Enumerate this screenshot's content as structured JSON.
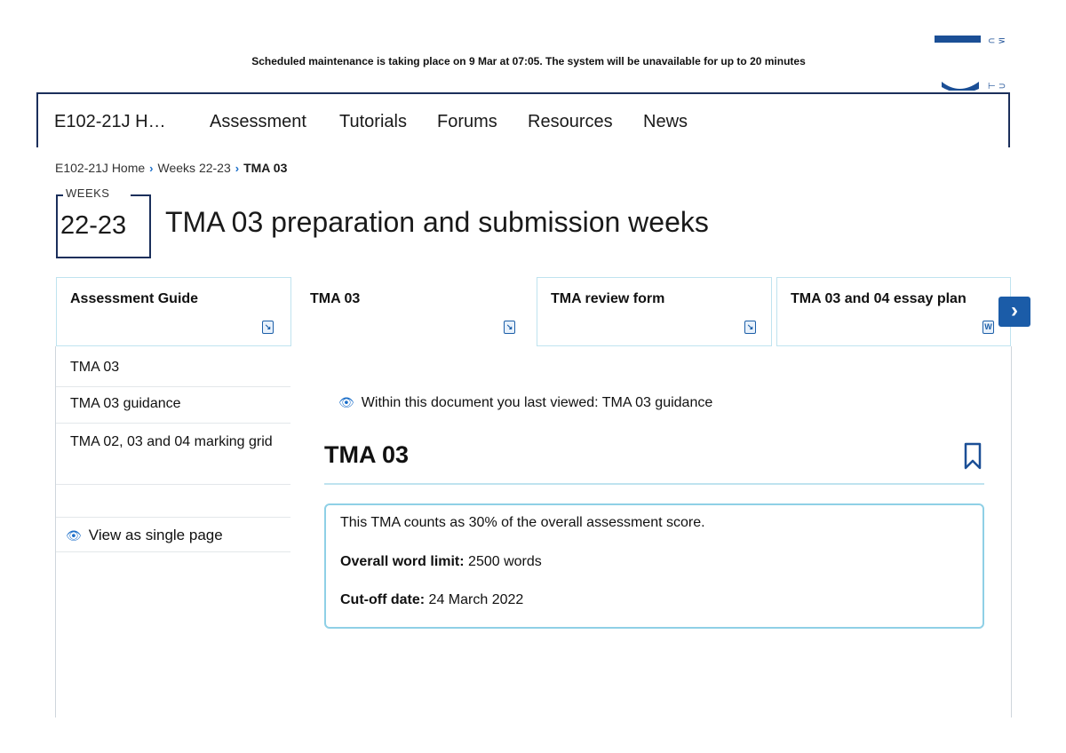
{
  "banner": {
    "text": "Scheduled maintenance is taking place on 9 Mar at 07:05. The system will be unavailable for up to 20 minutes"
  },
  "topnav": {
    "items": [
      "E102-21J H…",
      "Assessment",
      "Tutorials",
      "Forums",
      "Resources",
      "News"
    ]
  },
  "breadcrumb": {
    "items": [
      "E102-21J Home",
      "Weeks 22-23"
    ],
    "current": "TMA 03"
  },
  "week": {
    "label": "WEEKS",
    "number": "22-23",
    "title": "TMA 03 preparation and submission weeks"
  },
  "tabs": [
    {
      "label": "Assessment Guide",
      "icon": "document-icon",
      "active": false
    },
    {
      "label": "TMA 03",
      "icon": "document-icon",
      "active": true
    },
    {
      "label": "TMA review form",
      "icon": "document-icon",
      "active": false
    },
    {
      "label": "TMA 03 and 04 essay plan",
      "icon": "word-document-icon",
      "active": false
    }
  ],
  "tab_icon_glyphs": {
    "document": "↘",
    "word": "W"
  },
  "toc": {
    "items": [
      "TMA 03",
      "TMA 03 guidance",
      "TMA 02, 03 and 04 marking grid"
    ],
    "view_single": "View as single page"
  },
  "main": {
    "last_viewed": "Within this document you last viewed: TMA 03 guidance",
    "heading": "TMA 03",
    "info": {
      "line1": "This TMA counts as 30% of the overall assessment score.",
      "word_limit_label": "Overall word limit:",
      "word_limit_value": "2500 words",
      "cutoff_label": "Cut-off date:",
      "cutoff_value": "24 March 2022"
    }
  },
  "colors": {
    "brand_navy": "#1b2f5b",
    "accent_blue": "#1c6fc9",
    "tab_border": "#bfe3ef",
    "info_border": "#8fd0e6"
  }
}
